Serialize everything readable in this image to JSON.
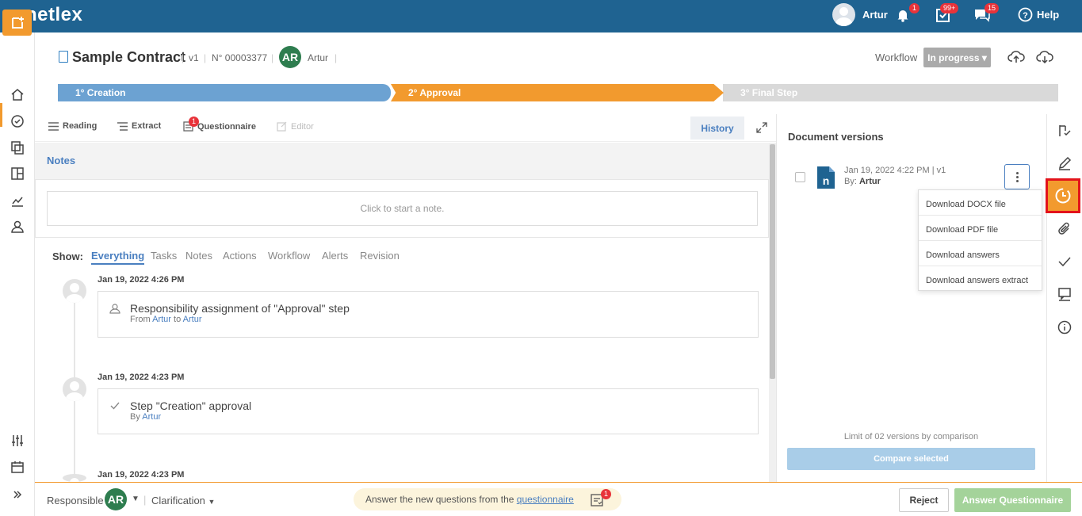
{
  "app": {
    "logo": "netlex"
  },
  "topbar": {
    "user_name": "Artur",
    "notifications_count": "1",
    "tasks_count": "99+",
    "messages_count": "15",
    "help_label": "Help"
  },
  "document": {
    "title": "Sample Contract",
    "version": "v1",
    "number": "N° 00003377",
    "owner_initials": "AR",
    "owner_name": "Artur",
    "workflow_label": "Workflow",
    "workflow_status": "In progress"
  },
  "steps": [
    {
      "label": "1° Creation"
    },
    {
      "label": "2° Approval"
    },
    {
      "label": "3° Final Step"
    }
  ],
  "tabs": {
    "reading": "Reading",
    "extract": "Extract",
    "questionnaire": "Questionnaire",
    "questionnaire_badge": "1",
    "editor": "Editor",
    "history": "History"
  },
  "notes": {
    "tab_label": "Notes",
    "placeholder": "Click to start a note."
  },
  "filters": {
    "show_label": "Show:",
    "items": [
      "Everything",
      "Tasks",
      "Notes",
      "Actions",
      "Workflow",
      "Alerts",
      "Revision"
    ]
  },
  "feed": [
    {
      "date": "Jan 19, 2022 4:26 PM",
      "title": "Responsibility assignment of \"Approval\" step",
      "sub_prefix": "From",
      "sub_link1": "Artur",
      "sub_mid": "to",
      "sub_link2": "Artur"
    },
    {
      "date": "Jan 19, 2022 4:23 PM",
      "title": "Step \"Creation\" approval",
      "sub_prefix": "By",
      "sub_link1": "Artur"
    },
    {
      "date": "Jan 19, 2022 4:23 PM"
    }
  ],
  "versions": {
    "title": "Document versions",
    "item_date": "Jan 19, 2022 4:22 PM | v1",
    "item_by_label": "By:",
    "item_by_name": "Artur",
    "menu": [
      "Download DOCX file",
      "Download PDF file",
      "Download answers",
      "Download answers extract"
    ],
    "limit_text": "Limit of 02 versions by comparison",
    "compare_label": "Compare selected"
  },
  "bottom": {
    "responsible_label": "Responsible",
    "responsible_initials": "AR",
    "clarification_label": "Clarification",
    "banner_text": "Answer the new questions from the",
    "banner_link": "questionnaire",
    "banner_badge": "1",
    "reject_label": "Reject",
    "answer_label": "Answer Questionnaire"
  },
  "colors": {
    "brand_blue": "#1f6391",
    "accent_orange": "#f29a2e",
    "link_blue": "#4a7fc0",
    "success_green": "#a4d39a",
    "alert_red": "#e8333a"
  }
}
